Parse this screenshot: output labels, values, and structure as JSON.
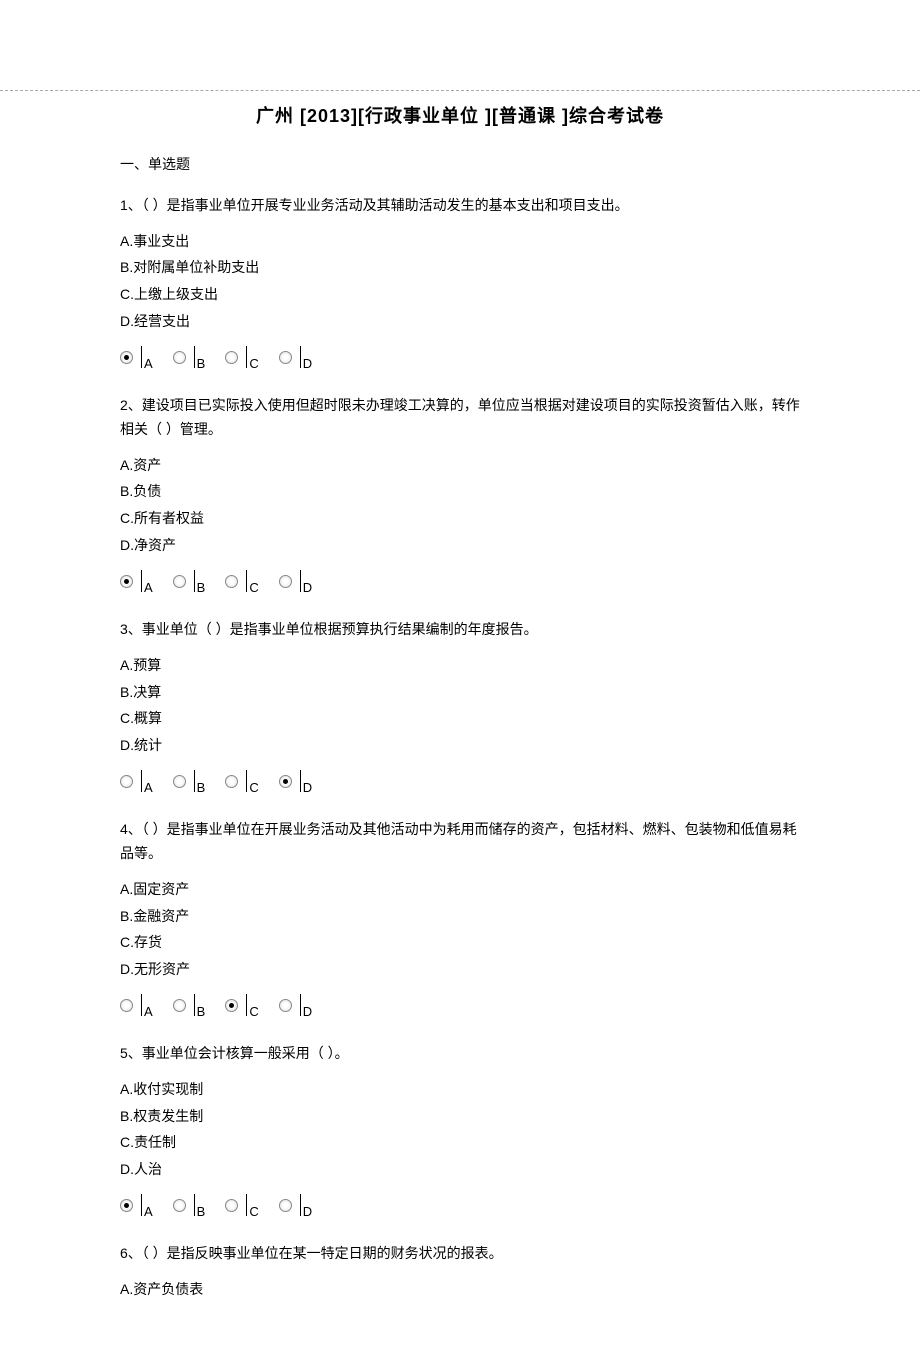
{
  "title": "广州 [2013][行政事业单位 ][普通课 ]综合考试卷",
  "section_title": "一、单选题",
  "radio_labels": [
    "A",
    "B",
    "C",
    "D"
  ],
  "questions": [
    {
      "text": "1、（        ）是指事业单位开展专业业务活动及其辅助活动发生的基本支出和项目支出。",
      "options": [
        "A.事业支出",
        "B.对附属单位补助支出",
        "C.上缴上级支出",
        "D.经营支出"
      ],
      "selected": 0
    },
    {
      "text": "2、建设项目已实际投入使用但超时限未办理竣工决算的，单位应当根据对建设项目的实际投资暂估入账，转作相关（        ）管理。",
      "options": [
        "A.资产",
        "B.负债",
        "C.所有者权益",
        "D.净资产"
      ],
      "selected": 0
    },
    {
      "text": "3、事业单位（        ）是指事业单位根据预算执行结果编制的年度报告。",
      "options": [
        "A.预算",
        "B.决算",
        "C.概算",
        "D.统计"
      ],
      "selected": 3
    },
    {
      "text": "4、（        ）是指事业单位在开展业务活动及其他活动中为耗用而储存的资产，包括材料、燃料、包装物和低值易耗品等。",
      "options": [
        "A.固定资产",
        "B.金融资产",
        "C.存货",
        "D.无形资产"
      ],
      "selected": 2
    },
    {
      "text": "5、事业单位会计核算一般采用（            ）。",
      "options": [
        "A.收付实现制",
        "B.权责发生制",
        "C.责任制",
        "D.人治"
      ],
      "selected": 0
    },
    {
      "text": "6、（        ）是指反映事业单位在某一特定日期的财务状况的报表。",
      "options": [
        "A.资产负债表"
      ],
      "selected": -1,
      "no_radios": true
    }
  ]
}
